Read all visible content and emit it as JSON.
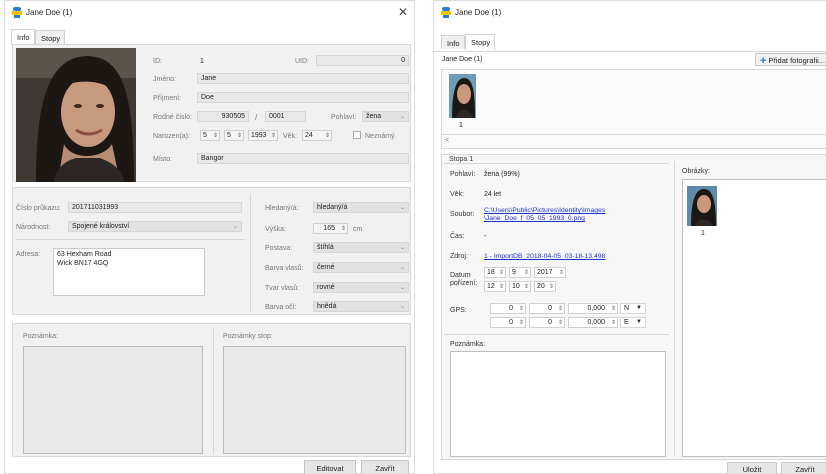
{
  "win1": {
    "title": "Jane Doe (1)",
    "tabs": [
      "Info",
      "Stopy"
    ],
    "id_label": "ID:",
    "id_value": "1",
    "uid_label": "UID:",
    "uid_value": "0",
    "jmeno_label": "Jméno:",
    "jmeno_value": "Jane",
    "prijmeni_label": "Příjmení:",
    "prijmeni_value": "Doe",
    "rodne_label": "Rodné číslo:",
    "rodne_value1": "930505",
    "rodne_sep": "/",
    "rodne_value2": "0001",
    "pohlavi_label": "Pohlaví:",
    "pohlavi_value": "žena",
    "narozen_label": "Narozen(a):",
    "narozen_d": "5",
    "narozen_m": "5",
    "narozen_y": "1993",
    "vek_label": "Věk:",
    "vek_value": "24",
    "neznamy_label": "Neznámý",
    "misto_label": "Místo:",
    "misto_value": "Bangor",
    "prukaz_label": "Číslo průkazu:",
    "prukaz_value": "201711031993",
    "narodnost_label": "Národnost:",
    "narodnost_value": "Spojené království",
    "adresa_label": "Adresa:",
    "adresa_line1": "63 Hexham Road",
    "adresa_line2": "Wick BN17 4GQ",
    "hledany_label": "Hledaný/á:",
    "hledany_value": "hledaný/á",
    "vyska_label": "Výška:",
    "vyska_value": "165",
    "vyska_unit": "cm",
    "postava_label": "Postava:",
    "postava_value": "štíhlá",
    "vlasy_label": "Barva vlasů:",
    "vlasy_value": "černé",
    "tvar_label": "Tvar vlasů:",
    "tvar_value": "rovné",
    "oci_label": "Barva očí:",
    "oci_value": "hnědá",
    "poznamka_label": "Poznámka:",
    "poznamky_stop_label": "Poznámky stop:",
    "edit_button": "Editovat",
    "close_button": "Zavřít"
  },
  "win2": {
    "title": "Jane Doe (1)",
    "tabs": [
      "Info",
      "Stopy"
    ],
    "header_name": "Jane Doe (1)",
    "add_photo_button": "Přidat fotografii...",
    "thumb_number": "1",
    "scroll_left": "<",
    "scroll_right": ">",
    "stopa_title": "Stopa 1",
    "pohlavi_label": "Pohlaví:",
    "pohlavi_value": "žena (99%)",
    "vek_label": "Věk:",
    "vek_value": "24 let",
    "soubor_label": "Soubor:",
    "soubor_line1": "C:\\Users\\Public\\Pictures\\Identity\\Images",
    "soubor_line2": "\\Jane_Doe_f_05_05_1993_0.png",
    "cas_label": "Čas:",
    "cas_value": "-",
    "zdroj_label": "Zdroj:",
    "zdroj_value": "1 - ImportDB_2018-04-05_03-18-13.498",
    "datum_label1": "Datum",
    "datum_label2": "pořízení:",
    "datum_d": "18",
    "datum_m": "9",
    "datum_y": "2017",
    "cas_h": "12",
    "cas_m": "10",
    "cas_s": "20",
    "gps_label": "GPS:",
    "gps1_a": "0",
    "gps1_b": "0",
    "gps1_c": "0,000",
    "gps1_dir": "N",
    "gps2_a": "0",
    "gps2_b": "0",
    "gps2_c": "0,000",
    "gps2_dir": "E",
    "poznamka_label": "Poznámka:",
    "obrazky_label": "Obrázky:",
    "obrazek_number": "1",
    "save_button": "Uložit",
    "close_button": "Zavřít"
  }
}
